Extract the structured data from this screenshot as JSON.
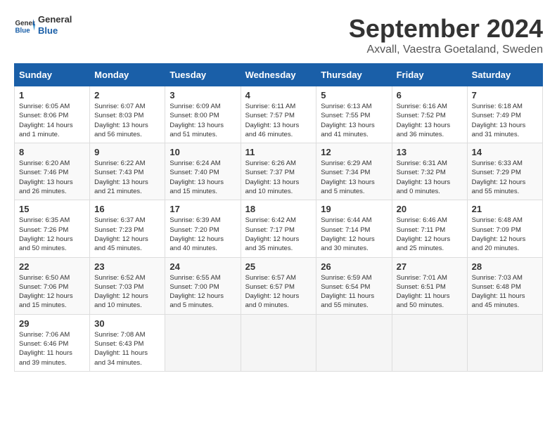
{
  "header": {
    "logo_line1": "General",
    "logo_line2": "Blue",
    "month_title": "September 2024",
    "location": "Axvall, Vaestra Goetaland, Sweden"
  },
  "days_of_week": [
    "Sunday",
    "Monday",
    "Tuesday",
    "Wednesday",
    "Thursday",
    "Friday",
    "Saturday"
  ],
  "weeks": [
    {
      "days": [
        {
          "num": "1",
          "info": "Sunrise: 6:05 AM\nSunset: 8:06 PM\nDaylight: 14 hours\nand 1 minute."
        },
        {
          "num": "2",
          "info": "Sunrise: 6:07 AM\nSunset: 8:03 PM\nDaylight: 13 hours\nand 56 minutes."
        },
        {
          "num": "3",
          "info": "Sunrise: 6:09 AM\nSunset: 8:00 PM\nDaylight: 13 hours\nand 51 minutes."
        },
        {
          "num": "4",
          "info": "Sunrise: 6:11 AM\nSunset: 7:57 PM\nDaylight: 13 hours\nand 46 minutes."
        },
        {
          "num": "5",
          "info": "Sunrise: 6:13 AM\nSunset: 7:55 PM\nDaylight: 13 hours\nand 41 minutes."
        },
        {
          "num": "6",
          "info": "Sunrise: 6:16 AM\nSunset: 7:52 PM\nDaylight: 13 hours\nand 36 minutes."
        },
        {
          "num": "7",
          "info": "Sunrise: 6:18 AM\nSunset: 7:49 PM\nDaylight: 13 hours\nand 31 minutes."
        }
      ]
    },
    {
      "days": [
        {
          "num": "8",
          "info": "Sunrise: 6:20 AM\nSunset: 7:46 PM\nDaylight: 13 hours\nand 26 minutes."
        },
        {
          "num": "9",
          "info": "Sunrise: 6:22 AM\nSunset: 7:43 PM\nDaylight: 13 hours\nand 21 minutes."
        },
        {
          "num": "10",
          "info": "Sunrise: 6:24 AM\nSunset: 7:40 PM\nDaylight: 13 hours\nand 15 minutes."
        },
        {
          "num": "11",
          "info": "Sunrise: 6:26 AM\nSunset: 7:37 PM\nDaylight: 13 hours\nand 10 minutes."
        },
        {
          "num": "12",
          "info": "Sunrise: 6:29 AM\nSunset: 7:34 PM\nDaylight: 13 hours\nand 5 minutes."
        },
        {
          "num": "13",
          "info": "Sunrise: 6:31 AM\nSunset: 7:32 PM\nDaylight: 13 hours\nand 0 minutes."
        },
        {
          "num": "14",
          "info": "Sunrise: 6:33 AM\nSunset: 7:29 PM\nDaylight: 12 hours\nand 55 minutes."
        }
      ]
    },
    {
      "days": [
        {
          "num": "15",
          "info": "Sunrise: 6:35 AM\nSunset: 7:26 PM\nDaylight: 12 hours\nand 50 minutes."
        },
        {
          "num": "16",
          "info": "Sunrise: 6:37 AM\nSunset: 7:23 PM\nDaylight: 12 hours\nand 45 minutes."
        },
        {
          "num": "17",
          "info": "Sunrise: 6:39 AM\nSunset: 7:20 PM\nDaylight: 12 hours\nand 40 minutes."
        },
        {
          "num": "18",
          "info": "Sunrise: 6:42 AM\nSunset: 7:17 PM\nDaylight: 12 hours\nand 35 minutes."
        },
        {
          "num": "19",
          "info": "Sunrise: 6:44 AM\nSunset: 7:14 PM\nDaylight: 12 hours\nand 30 minutes."
        },
        {
          "num": "20",
          "info": "Sunrise: 6:46 AM\nSunset: 7:11 PM\nDaylight: 12 hours\nand 25 minutes."
        },
        {
          "num": "21",
          "info": "Sunrise: 6:48 AM\nSunset: 7:09 PM\nDaylight: 12 hours\nand 20 minutes."
        }
      ]
    },
    {
      "days": [
        {
          "num": "22",
          "info": "Sunrise: 6:50 AM\nSunset: 7:06 PM\nDaylight: 12 hours\nand 15 minutes."
        },
        {
          "num": "23",
          "info": "Sunrise: 6:52 AM\nSunset: 7:03 PM\nDaylight: 12 hours\nand 10 minutes."
        },
        {
          "num": "24",
          "info": "Sunrise: 6:55 AM\nSunset: 7:00 PM\nDaylight: 12 hours\nand 5 minutes."
        },
        {
          "num": "25",
          "info": "Sunrise: 6:57 AM\nSunset: 6:57 PM\nDaylight: 12 hours\nand 0 minutes."
        },
        {
          "num": "26",
          "info": "Sunrise: 6:59 AM\nSunset: 6:54 PM\nDaylight: 11 hours\nand 55 minutes."
        },
        {
          "num": "27",
          "info": "Sunrise: 7:01 AM\nSunset: 6:51 PM\nDaylight: 11 hours\nand 50 minutes."
        },
        {
          "num": "28",
          "info": "Sunrise: 7:03 AM\nSunset: 6:48 PM\nDaylight: 11 hours\nand 45 minutes."
        }
      ]
    },
    {
      "days": [
        {
          "num": "29",
          "info": "Sunrise: 7:06 AM\nSunset: 6:46 PM\nDaylight: 11 hours\nand 39 minutes."
        },
        {
          "num": "30",
          "info": "Sunrise: 7:08 AM\nSunset: 6:43 PM\nDaylight: 11 hours\nand 34 minutes."
        },
        {
          "num": "",
          "info": ""
        },
        {
          "num": "",
          "info": ""
        },
        {
          "num": "",
          "info": ""
        },
        {
          "num": "",
          "info": ""
        },
        {
          "num": "",
          "info": ""
        }
      ]
    }
  ]
}
